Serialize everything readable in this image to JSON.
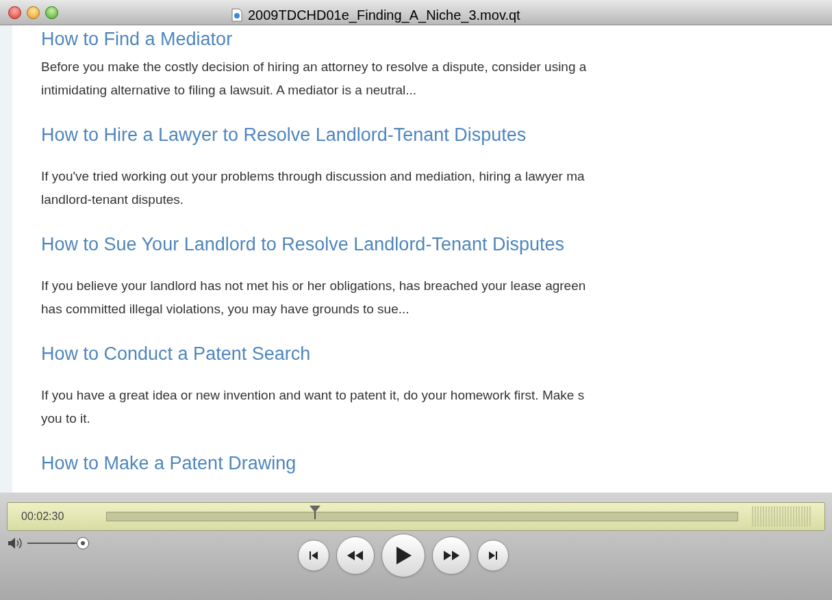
{
  "window": {
    "title": "2009TDCHD01e_Finding_A_Niche_3.mov.qt"
  },
  "video_page": {
    "articles": [
      {
        "heading": "How to Find a Mediator",
        "body_lines": [
          "Before you make the costly decision of hiring an attorney to resolve a dispute, consider using a",
          "intimidating alternative to filing a lawsuit. A mediator is a neutral..."
        ]
      },
      {
        "heading": "How to Hire a Lawyer to Resolve Landlord-Tenant Disputes",
        "body_lines": [
          "If you've tried working out your problems through discussion and mediation, hiring a lawyer ma",
          "landlord-tenant disputes."
        ]
      },
      {
        "heading": "How to Sue Your Landlord to Resolve Landlord-Tenant Disputes",
        "body_lines": [
          "If you believe your landlord has not met his or her obligations, has breached your lease agreen",
          "has committed illegal violations, you may have grounds to sue..."
        ]
      },
      {
        "heading": "How to Conduct a Patent Search",
        "body_lines": [
          "If you have a great idea or new invention and want to patent it, do your homework first. Make s",
          "you to it."
        ]
      },
      {
        "heading": "How to Make a Patent Drawing"
      }
    ]
  },
  "controls": {
    "time": "00:02:30",
    "progress": {
      "level": 0.33
    },
    "volume": {
      "level": 1.0
    }
  }
}
